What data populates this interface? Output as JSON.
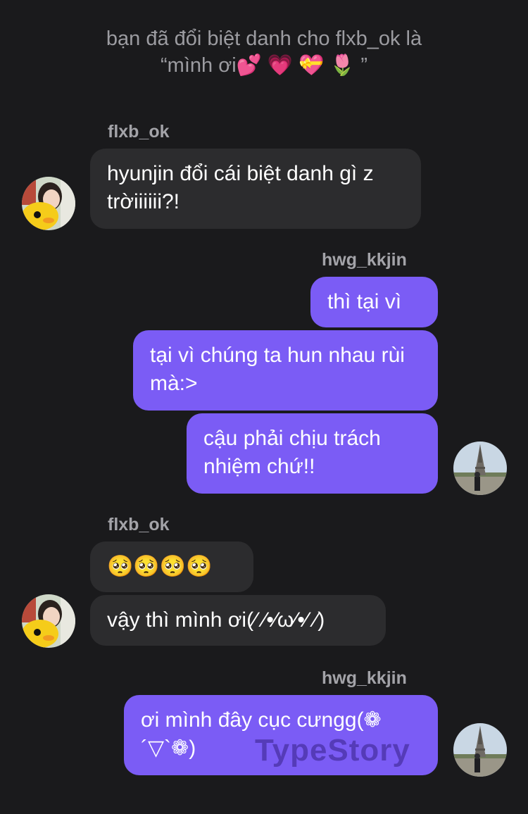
{
  "system_note": {
    "line1": "bạn đã đổi biệt danh cho flxb_ok là",
    "line2": "“mình ơi💕 💗 💝 🌷 ”"
  },
  "messages": [
    {
      "sender": "flxb_ok",
      "text": "hyunjin đổi cái biệt danh gì z trờiiiiii?!"
    },
    {
      "sender": "hwg_kkjin",
      "text": "thì tại vì"
    },
    {
      "text": "tại vì chúng ta hun nhau rùi mà:>"
    },
    {
      "text": "cậu phải chịu trách nhiệm chứ!!"
    },
    {
      "sender": "flxb_ok",
      "text": "🥺🥺🥺🥺"
    },
    {
      "text": "vậy thì mình ơi(⁄ ⁄•⁄ω⁄•⁄ ⁄)"
    },
    {
      "sender": "hwg_kkjin",
      "text": "ơi mình đây cục cưngg(❁´▽`❁)"
    }
  ],
  "watermark": "TypeStory",
  "colors": {
    "background": "#1a1a1c",
    "incoming_bubble": "#2c2c2e",
    "outgoing_bubble": "#7b5cf5",
    "meta_text": "#a3a3a8"
  },
  "icons": {
    "avatar_left": "avatar-photo-boy-with-duck-plush",
    "avatar_right": "avatar-photo-eiffel-tower"
  }
}
